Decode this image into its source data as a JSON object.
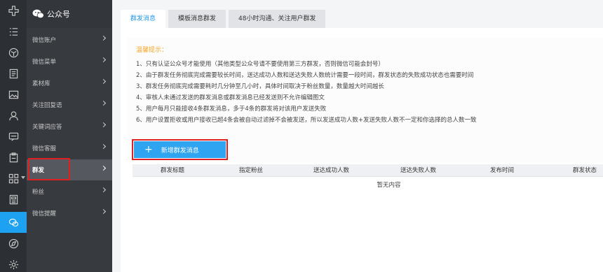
{
  "rail": {
    "icons": [
      "plus-cross-icon",
      "list-icon",
      "cube-icon",
      "document-icon",
      "image-icon",
      "user-icon",
      "chat-box-icon",
      "clipboard-icon",
      "apps-icon",
      "report-icon",
      "wechat-icon",
      "compass-icon",
      "settings-icon"
    ],
    "active_index": 10
  },
  "sidebar": {
    "title": "公众号",
    "items": [
      {
        "label": "微信账户"
      },
      {
        "label": "微信菜单"
      },
      {
        "label": "素材库"
      },
      {
        "label": "关注回复语"
      },
      {
        "label": "关键词应答"
      },
      {
        "label": "微信客服"
      },
      {
        "label": "群发"
      },
      {
        "label": "粉丝"
      },
      {
        "label": "微信提醒"
      }
    ],
    "active_index": 6
  },
  "tabs": [
    {
      "label": "群发消息"
    },
    {
      "label": "模板消息群发"
    },
    {
      "label": "48小时沟通、关注用户群发"
    }
  ],
  "tip": {
    "title": "温馨提示：",
    "lines": [
      "1、只有认证公众号才能使用（其他类型公众号请不要使用第三方群发，否则微信可能会封号）",
      "2、由于群发任务彻底完成需要较长时间，送达成功人数和送达失败人数统计需要一段时间，群发状态的失败成功状态也需要时间",
      "3、群发任务彻底完成需要耗时几分钟至几小时，具体时间取决于粉丝数量，数量越大时间越长",
      "4、审核人未通过发送的群发消息或群发消息已经发送则不允许编辑图文",
      "5、用户每月只能接收4条群发消息，多于4条的群发将对该用户发送失败",
      "6、用户设置拒收或用户接收已超4条会被自动过滤掉不会被发送，所以发送成功人数+发送失败人数不一定和你选择的总人数一致"
    ]
  },
  "new_button": {
    "label": "新增群发消息"
  },
  "table": {
    "columns": [
      "群发标题",
      "指定粉丝",
      "送达成功人数",
      "送达失败人数",
      "发布时间",
      "群发状态"
    ],
    "empty_text": "暂无内容"
  },
  "colors": {
    "accent": "#2fa4f0",
    "highlight": "#e02020",
    "tip_title": "#f5a623",
    "rail_bg": "#2c2f33",
    "side_bg": "#373a3f"
  }
}
